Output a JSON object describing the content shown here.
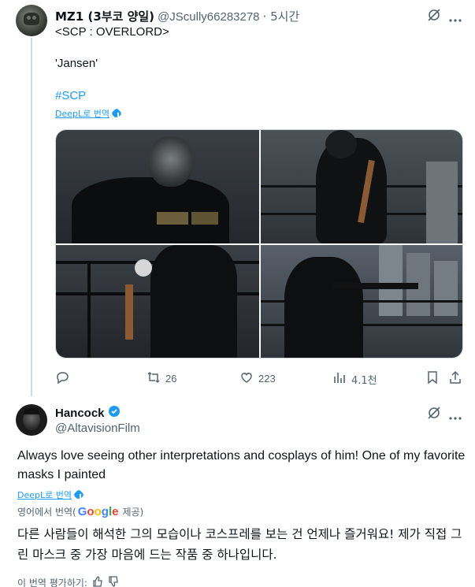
{
  "tweet1": {
    "author_name": "MZ1 (3부코 양일)",
    "handle": "@JScully66283278",
    "time": "· 5시간",
    "line1": "<SCP : OVERLORD>",
    "line2": "'Jansen'",
    "hashtag": "#SCP",
    "translate_label": "DeepL로 번역",
    "actions": {
      "reply": "",
      "retweets": "26",
      "likes": "223",
      "views": "4.1천"
    }
  },
  "tweet2": {
    "author_name": "Hancock",
    "handle": "@AltavisionFilm",
    "text": "Always love seeing other interpretations and cosplays of him! One of my favorite masks I painted",
    "translate_label": "DeepL로 번역",
    "translated_from": "영어에서 번역(",
    "google": [
      "G",
      "o",
      "o",
      "g",
      "l",
      "e"
    ],
    "provided": "제공)",
    "translation": "다른 사람들이 해석한 그의 모습이나 코스프레를 보는 건 언제나 즐거워요! 제가 직접 그린 마스크 중 가장 마음에 드는 작품 중 하나입니다.",
    "rate": "이 번역 평가하기:"
  },
  "colors": {
    "accent": "#1d9bf0",
    "muted": "#536471",
    "text": "#0f1419"
  },
  "icons": [
    "grok-icon",
    "more-icon",
    "reply-icon",
    "retweet-icon",
    "like-icon",
    "views-icon",
    "bookmark-icon",
    "share-icon",
    "verified-icon",
    "thumbs-up-icon",
    "thumbs-down-icon"
  ]
}
